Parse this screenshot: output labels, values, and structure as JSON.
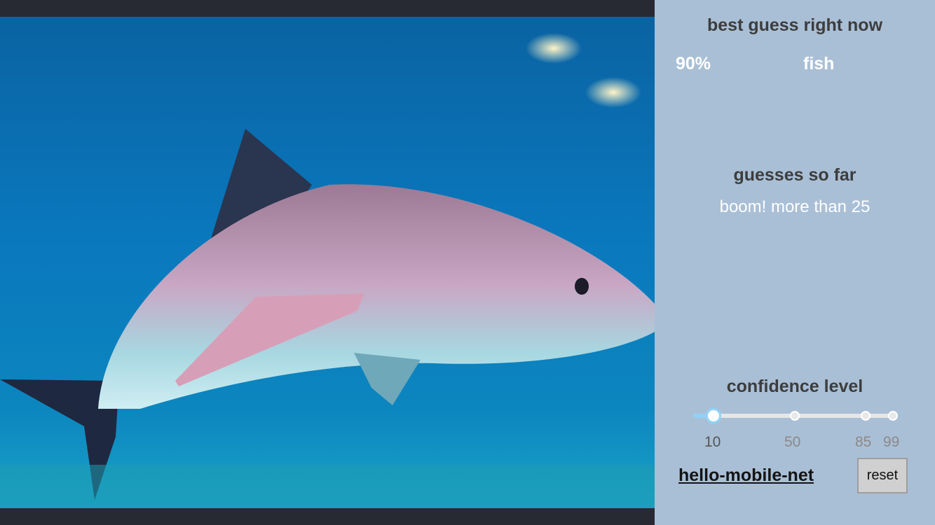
{
  "panel": {
    "best_guess_heading": "best guess right now",
    "best_guess_percent": "90%",
    "best_guess_label": "fish",
    "guesses_heading": "guesses so far",
    "guesses_text": "boom! more than 25",
    "confidence_heading": "confidence level",
    "confidence": {
      "selected": 10,
      "marks": [
        "10",
        "50",
        "85",
        "99"
      ]
    },
    "link_text": "hello-mobile-net",
    "reset_label": "reset"
  },
  "colors": {
    "panel_bg": "#a9bfd6",
    "letterbox": "#272a33",
    "slider_accent": "#92d4f8"
  }
}
